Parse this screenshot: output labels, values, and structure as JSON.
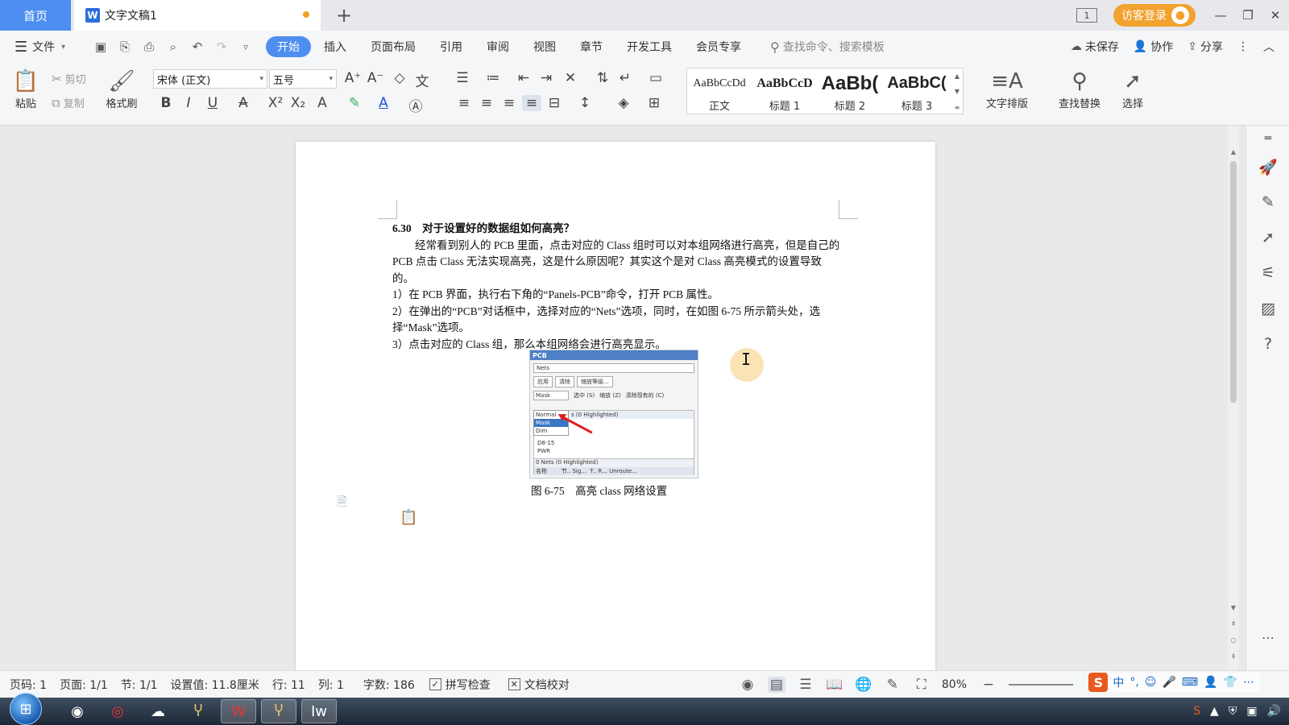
{
  "titlebar": {
    "home_tab": "首页",
    "doc_tab_icon": "W",
    "doc_tab_title": "文字文稿1",
    "new_tab": "+",
    "page_indicator": "1",
    "login_label": "访客登录",
    "win_min": "—",
    "win_restore": "❐",
    "win_close": "✕"
  },
  "menubar": {
    "file_label": "文件",
    "tabs": [
      "开始",
      "插入",
      "页面布局",
      "引用",
      "审阅",
      "视图",
      "章节",
      "开发工具",
      "会员专享"
    ],
    "active_tab": "开始",
    "search_placeholder": "查找命令、搜索模板",
    "unsaved": "未保存",
    "collaborate": "协作",
    "share": "分享"
  },
  "ribbon": {
    "paste": "粘贴",
    "cut": "剪切",
    "copy": "复制",
    "format_painter": "格式刷",
    "font_name": "宋体 (正文)",
    "font_size": "五号",
    "styles": [
      {
        "sample": "AaBbCcDd",
        "name": "正文"
      },
      {
        "sample": "AaBbCcD",
        "name": "标题 1"
      },
      {
        "sample": "AaBb(",
        "name": "标题 2"
      },
      {
        "sample": "AaBbC(",
        "name": "标题 3"
      }
    ],
    "text_layout": "文字排版",
    "find_replace": "查找替换",
    "select": "选择"
  },
  "document": {
    "heading": "6.30　对于设置好的数据组如何高亮？",
    "paragraph": "经常看到别人的 PCB 里面，点击对应的 Class 组时可以对本组网络进行高亮，但是自己的 PCB 点击 Class 无法实现高亮，这是什么原因呢？其实这个是对 Class 高亮模式的设置导致的。",
    "step1": "1）在 PCB 界面，执行右下角的“Panels-PCB”命令，打开 PCB 属性。",
    "step2": "2）在弹出的“PCB”对话框中，选择对应的“Nets”选项，同时，在如图 6-75 所示箭头处，选择“Mask”选项。",
    "step3": "3）点击对应的 Class 组，那么本组网络会进行高亮显示。",
    "figure": {
      "title": "PCB",
      "nets_select": "Nets",
      "btn_apply": "应用",
      "btn_clear": "清除",
      "btn_zoom": "缩放等级...",
      "mask_value": "Mask",
      "opt_select": "选中 (S)",
      "opt_zoom": "缩放 (Z)",
      "opt_clear": "清除现有的 (C)",
      "dropdown": [
        "Normal",
        "Mask",
        "Dim"
      ],
      "list_header": "s (0 Highlighted)",
      "list_items": [
        "D8-15",
        "PWR"
      ],
      "bottom_header": "0 Nets (0 Highlighted)",
      "bottom_cols": "名称        节.. Sig...  T.. R... Unroute..."
    },
    "caption": "图 6-75　高亮 class 网络设置"
  },
  "statusbar": {
    "page_code": "页码: 1",
    "page": "页面: 1/1",
    "section": "节: 1/1",
    "position": "设置值: 11.8厘米",
    "line": "行: 11",
    "column": "列: 1",
    "word_count": "字数: 186",
    "spell_check": "拼写检查",
    "doc_proof": "文档校对",
    "zoom": "80%"
  },
  "ime": {
    "items": [
      "中",
      "°,",
      "☺",
      "🎤",
      "⌨",
      "👤",
      "👕",
      "⋯"
    ]
  },
  "colors": {
    "accent": "#4d8ef0",
    "login": "#f2a22e"
  }
}
